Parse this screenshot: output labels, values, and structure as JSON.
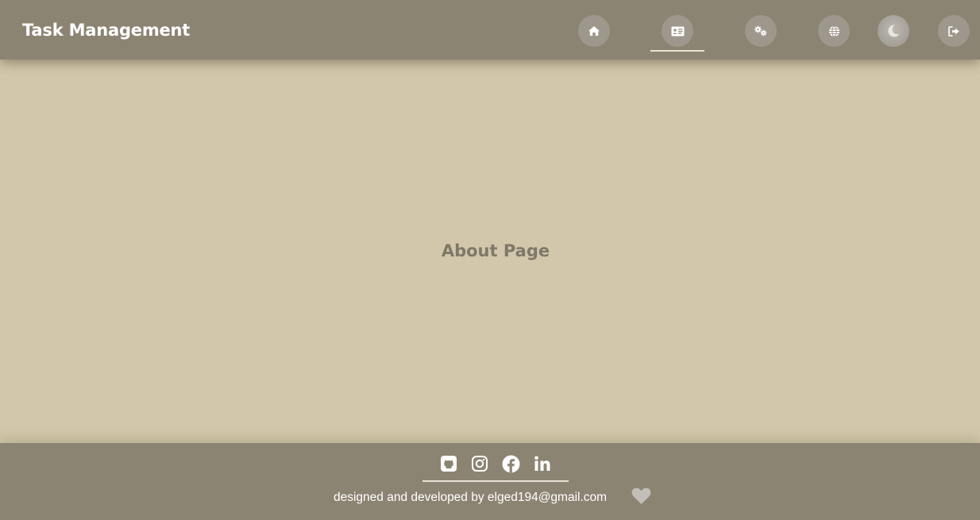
{
  "header": {
    "title": "Task Management",
    "nav": [
      {
        "icon": "home-icon",
        "active": false
      },
      {
        "icon": "id-card-icon",
        "active": true
      },
      {
        "icon": "gears-icon",
        "active": false
      },
      {
        "icon": "globe-icon",
        "active": false
      },
      {
        "icon": "moon-icon",
        "active": false
      },
      {
        "icon": "logout-icon",
        "active": false
      }
    ]
  },
  "main": {
    "heading": "About Page"
  },
  "footer": {
    "social": [
      "github-icon",
      "instagram-icon",
      "facebook-icon",
      "linkedin-icon"
    ],
    "credit": "designed and developed by elged194@gmail.com",
    "heart_icon": "heart-icon"
  },
  "colors": {
    "header_bg": "#8c8472",
    "page_bg": "#d3c7ab",
    "nav_button_bg": "#9d978c",
    "heading_text": "#7e7868"
  }
}
